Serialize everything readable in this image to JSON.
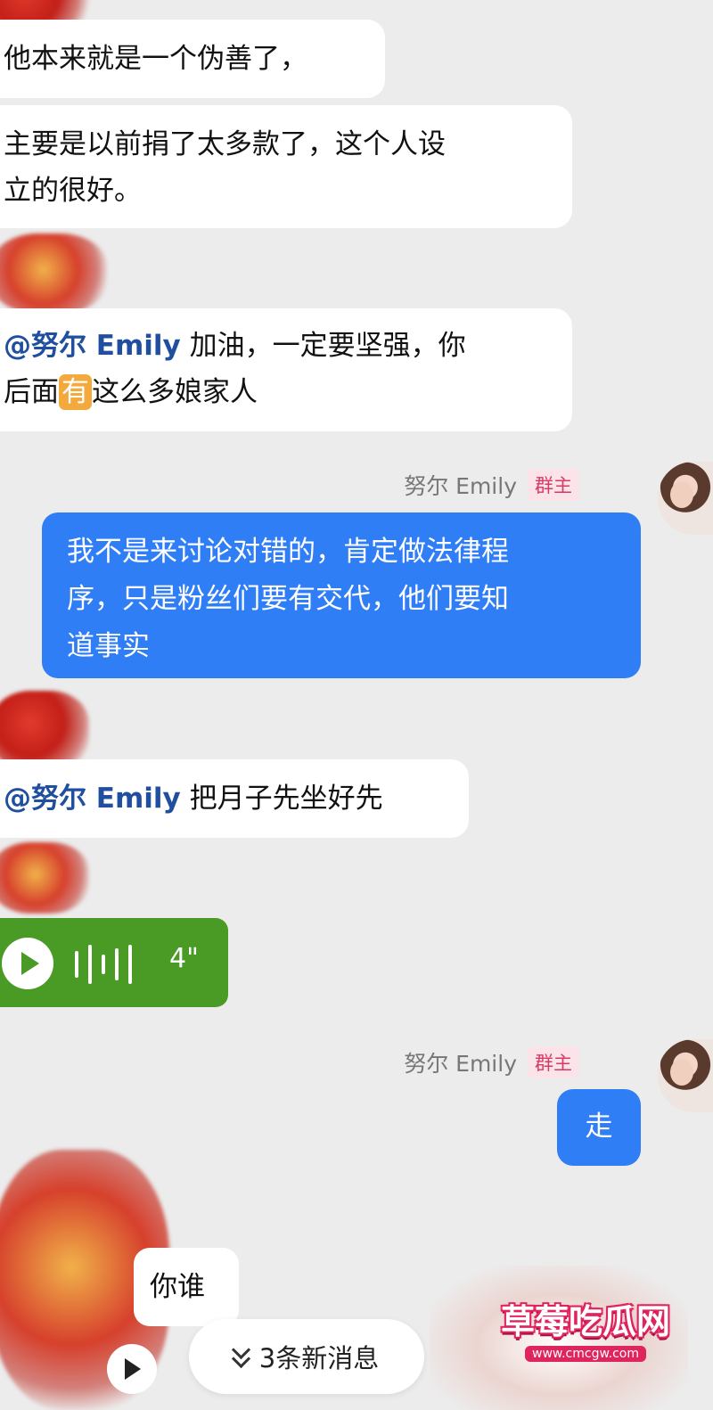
{
  "messages": {
    "m1": "他本来就是一个伪善了，",
    "m2_line1": "主要是以前捐了太多款了，这个人设",
    "m2_line2": "立的很好。",
    "m3_mention": "@努尔 Emily",
    "m3_line1_rest": " 加油，一定要坚强，你",
    "m3_line2_a": "后面",
    "m3_line2_hl": "有",
    "m3_line2_b": "这么多娘家人",
    "m4_line1": "我不是来讨论对错的，肯定做法律程",
    "m4_line2": "序，只是粉丝们要有交代，他们要知",
    "m4_line3": "道事实",
    "m5_mention": "@努尔 Emily",
    "m5_rest": " 把月子先坐好先",
    "m6_duration": "4\"",
    "m7": "走",
    "m8": "你谁"
  },
  "sender": {
    "name": "努尔 Emily",
    "badge": "群主"
  },
  "new_messages": {
    "label": "3条新消息"
  },
  "watermark": {
    "title": "草莓吃瓜网",
    "url": "www.cmcgw.com"
  },
  "icons": {
    "play": "play-icon",
    "chevron": "double-chevron-down-icon"
  },
  "colors": {
    "outgoing_bubble": "#2f7ef5",
    "voice_bubble": "#4a9b25",
    "mention": "#1f4f9e",
    "owner_badge_text": "#d83a64"
  }
}
